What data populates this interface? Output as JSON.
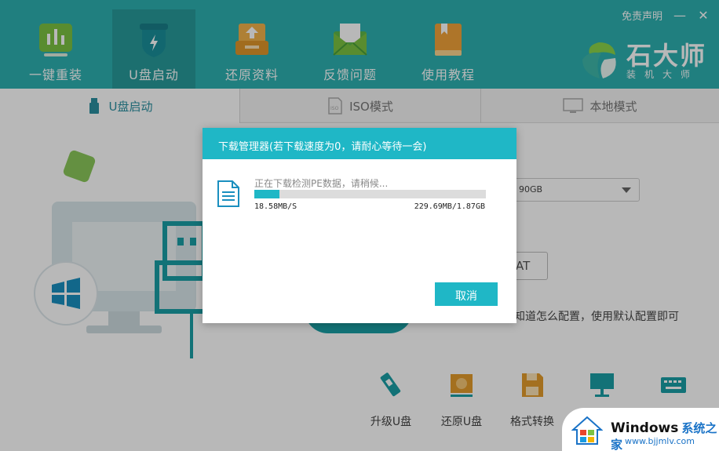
{
  "nav": {
    "items": [
      {
        "label": "一键重装",
        "icon": "chart-bars-icon"
      },
      {
        "label": "U盘启动",
        "icon": "usb-shield-icon"
      },
      {
        "label": "还原资料",
        "icon": "restore-box-icon"
      },
      {
        "label": "反馈问题",
        "icon": "mail-icon"
      },
      {
        "label": "使用教程",
        "icon": "book-icon"
      }
    ],
    "active_index": 1
  },
  "header": {
    "disclaimer": "免责声明",
    "minimize_glyph": "—",
    "close_glyph": "✕",
    "brand_name": "石大师",
    "brand_sub": "装机大师"
  },
  "tabs": [
    {
      "label": "U盘启动",
      "icon": "usb-drive-icon"
    },
    {
      "label": "ISO模式",
      "icon": "iso-disc-icon"
    },
    {
      "label": "本地模式",
      "icon": "monitor-icon"
    }
  ],
  "background": {
    "device_select_value": "90GB",
    "format_button_label": "AT",
    "hint_text": "知道怎么配置，使用默认配置即可",
    "tools": [
      {
        "label": "升级U盘",
        "icon": "usb-stick-icon"
      },
      {
        "label": "还原U盘",
        "icon": "restore-disk-icon"
      },
      {
        "label": "格式转换",
        "icon": "floppy-icon"
      },
      {
        "label": "",
        "icon": "monitor-tool-icon"
      },
      {
        "label": "",
        "icon": "keyboard-icon"
      }
    ]
  },
  "dialog": {
    "title": "下载管理器(若下载速度为0，请耐心等待一会)",
    "status": "正在下载检测PE数据，请稍候...",
    "progress_fraction": 0.11,
    "speed": "18.58MB/S",
    "size": "229.69MB/1.87GB",
    "cancel_label": "取消"
  },
  "watermark": {
    "title": "Windows",
    "title_cn": "系统之家",
    "url": "www.bjjmlv.com"
  },
  "colors": {
    "header_bg": "#2db0b0",
    "accent": "#1fb7c6",
    "tab_active_text": "#2a8fa0"
  }
}
